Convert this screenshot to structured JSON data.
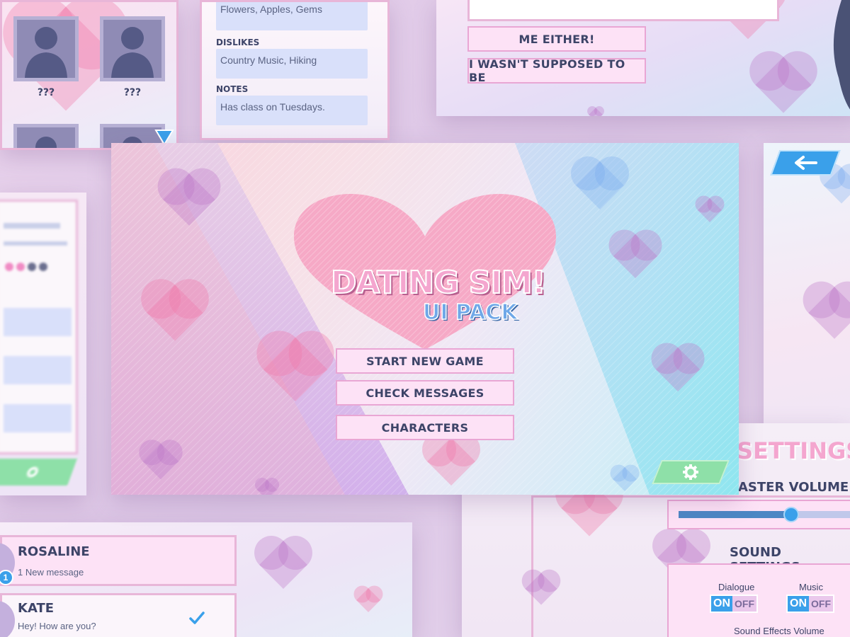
{
  "characters_panel": {
    "unknown_1": "???",
    "unknown_2": "???"
  },
  "profile_panel": {
    "likes_value": "Flowers, Apples, Gems",
    "dislikes_label": "DISLIKES",
    "dislikes_value": "Country Music, Hiking",
    "notes_label": "NOTES",
    "notes_value": "Has class on Tuesdays."
  },
  "dialogue_panel": {
    "choice_1": "ME EITHER!",
    "choice_2": "I WASN'T SUPPOSED TO BE"
  },
  "main_menu": {
    "title": "DATING SIM!",
    "subtitle": "UI PACK",
    "start_button": "START NEW GAME",
    "messages_button": "CHECK MESSAGES",
    "characters_button": "CHARACTERS",
    "icons": {
      "settings": "gear-icon"
    },
    "colors": {
      "title_pink": "#f4a6cf",
      "subtitle_blue": "#6fa8e8",
      "button_fill": "#fde2f6",
      "button_border": "#e9a6d4",
      "settings_green": "#8ee0a8"
    }
  },
  "back_panel": {
    "icons": {
      "back": "arrow-left-icon"
    },
    "accent": "#3aa0ea"
  },
  "settings_panel": {
    "title": "SETTINGS",
    "master_volume_label": "ASTER VOLUME",
    "master_volume_level": 0.68,
    "sound_settings_title": "SOUND SETTINGS",
    "dialogue_label": "Dialogue",
    "music_label": "Music",
    "on_label": "ON",
    "off_label": "OFF",
    "sound_effects_label": "Sound Effects Volume"
  },
  "messages_panel": {
    "items": [
      {
        "name": "ROSALINE",
        "preview": "1 New message",
        "badge": "1"
      },
      {
        "name": "KATE",
        "preview": "Hey! How are you?",
        "status": "checkmark-icon"
      }
    ]
  }
}
